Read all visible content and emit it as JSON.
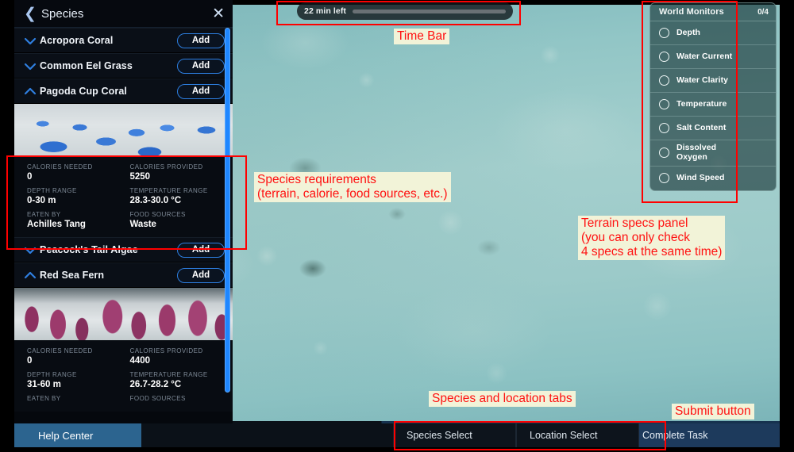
{
  "window": {
    "title": "Species"
  },
  "timebar": {
    "label": "22 min left",
    "progress_percent": 18,
    "fill_color": "#4fd978"
  },
  "sidebar": {
    "back_icon": "chevron-left-icon",
    "title": "Species",
    "close_icon": "close-icon",
    "add_label": "Add",
    "species": [
      {
        "name": "Acropora Coral",
        "expanded": false,
        "caret": "chevron-down-icon",
        "add_label": "Add"
      },
      {
        "name": "Common Eel Grass",
        "expanded": false,
        "caret": "chevron-down-icon",
        "add_label": "Add"
      },
      {
        "name": "Pagoda Cup Coral",
        "expanded": true,
        "caret": "chevron-up-icon",
        "add_label": "Add",
        "photo": "pagoda-cup-coral-photo",
        "stats": [
          {
            "key": "CALORIES NEEDED",
            "value": "0"
          },
          {
            "key": "CALORIES PROVIDED",
            "value": "5250"
          },
          {
            "key": "DEPTH RANGE",
            "value": "0-30 m"
          },
          {
            "key": "TEMPERATURE RANGE",
            "value": "28.3-30.0 °C"
          },
          {
            "key": "EATEN BY",
            "value": "Achilles Tang"
          },
          {
            "key": "FOOD SOURCES",
            "value": "Waste"
          }
        ]
      },
      {
        "name": "Peacock's Tail Algae",
        "expanded": false,
        "caret": "chevron-down-icon",
        "add_label": "Add"
      },
      {
        "name": "Red Sea Fern",
        "expanded": true,
        "caret": "chevron-up-icon",
        "add_label": "Add",
        "photo": "red-sea-fern-photo",
        "stats": [
          {
            "key": "CALORIES NEEDED",
            "value": "0"
          },
          {
            "key": "CALORIES PROVIDED",
            "value": "4400"
          },
          {
            "key": "DEPTH RANGE",
            "value": "31-60 m"
          },
          {
            "key": "TEMPERATURE RANGE",
            "value": "26.7-28.2 °C"
          },
          {
            "key": "EATEN BY",
            "value": ""
          },
          {
            "key": "FOOD SOURCES",
            "value": ""
          }
        ]
      }
    ]
  },
  "monitors": {
    "title": "World Monitors",
    "count": "0/4",
    "items": [
      {
        "label": "Depth",
        "checked": false
      },
      {
        "label": "Water Current",
        "checked": false
      },
      {
        "label": "Water Clarity",
        "checked": false
      },
      {
        "label": "Temperature",
        "checked": false
      },
      {
        "label": "Salt Content",
        "checked": false
      },
      {
        "label": "Dissolved\nOxygen",
        "checked": false
      },
      {
        "label": "Wind Speed",
        "checked": false
      }
    ]
  },
  "bottombar": {
    "help": "Help Center",
    "tabs": [
      {
        "label": "Species Select",
        "active": true
      },
      {
        "label": "Location Select",
        "active": false
      }
    ],
    "submit": "Complete Task"
  },
  "annotations": {
    "accent_color": "#ff0000",
    "label_bg": "#f2f3d8",
    "items": [
      {
        "name": "time-bar",
        "text": "Time Bar"
      },
      {
        "name": "species-requirements",
        "text": "Species requirements\n(terrain, calorie, food sources, etc.)"
      },
      {
        "name": "terrain-specs-panel",
        "text": "Terrain specs panel\n(you can only check\n4 specs at the same time)"
      },
      {
        "name": "species-location-tabs",
        "text": "Species and location tabs"
      },
      {
        "name": "submit-button",
        "text": "Submit button"
      }
    ]
  }
}
